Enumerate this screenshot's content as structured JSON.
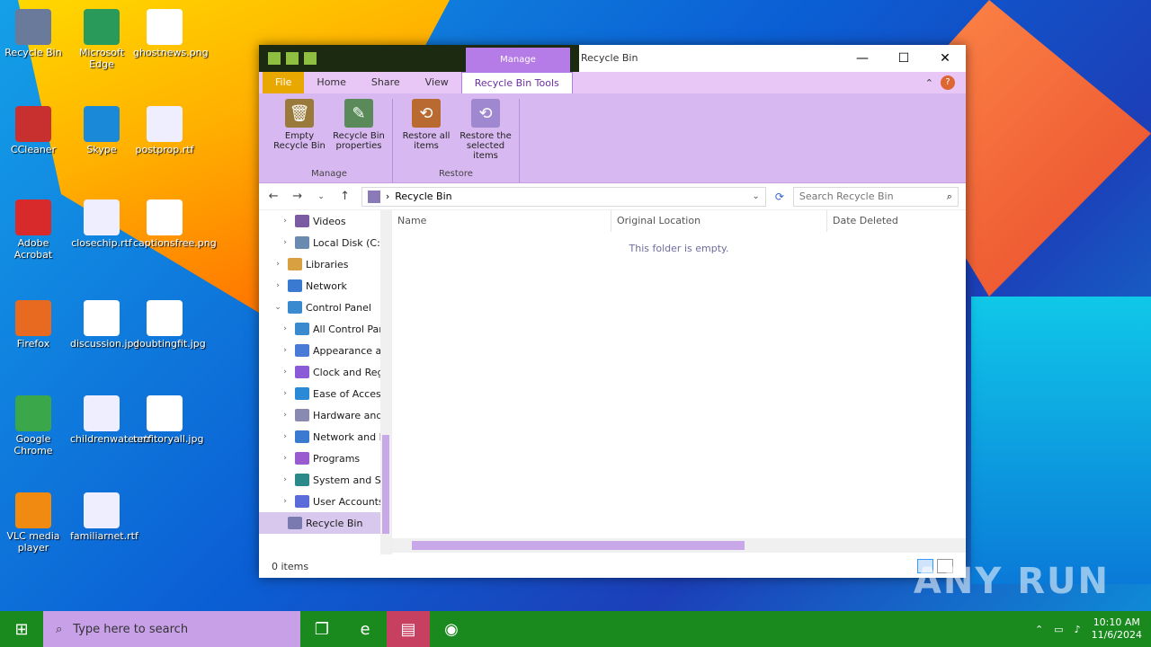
{
  "desktop": {
    "icons": [
      {
        "label": "Recycle Bin",
        "icon": "recycle-bin-icon"
      },
      {
        "label": "Microsoft Edge",
        "icon": "edge-icon"
      },
      {
        "label": "ghostnews.png",
        "icon": "image-file-icon"
      },
      {
        "label": "CCleaner",
        "icon": "ccleaner-icon"
      },
      {
        "label": "Skype",
        "icon": "skype-icon"
      },
      {
        "label": "postprop.rtf",
        "icon": "document-icon"
      },
      {
        "label": "Adobe Acrobat",
        "icon": "acrobat-icon"
      },
      {
        "label": "closechip.rtf",
        "icon": "document-icon"
      },
      {
        "label": "captionsfree.png",
        "icon": "image-file-icon"
      },
      {
        "label": "Firefox",
        "icon": "firefox-icon"
      },
      {
        "label": "discussion.jpg",
        "icon": "image-file-icon"
      },
      {
        "label": "doubtingfit.jpg",
        "icon": "image-file-icon"
      },
      {
        "label": "Google Chrome",
        "icon": "chrome-icon"
      },
      {
        "label": "childrenwater.rtf",
        "icon": "document-icon"
      },
      {
        "label": "territoryall.jpg",
        "icon": "image-file-icon"
      },
      {
        "label": "VLC media player",
        "icon": "vlc-icon"
      },
      {
        "label": "familiarnet.rtf",
        "icon": "document-icon"
      }
    ]
  },
  "window": {
    "context_tab": "Manage",
    "title": "Recycle Bin",
    "controls": {
      "minimize": "—",
      "maximize": "☐",
      "close": "✕"
    },
    "ribbon_tabs": [
      "File",
      "Home",
      "Share",
      "View",
      "Recycle Bin Tools"
    ],
    "ribbon": {
      "manage_group": {
        "label": "Manage",
        "buttons": [
          "Empty Recycle Bin",
          "Recycle Bin properties"
        ]
      },
      "restore_group": {
        "label": "Restore",
        "buttons": [
          "Restore all items",
          "Restore the selected items"
        ]
      }
    },
    "address": {
      "path": "Recycle Bin",
      "search_placeholder": "Search Recycle Bin"
    },
    "nav_items": [
      {
        "label": "Videos",
        "indent": 2,
        "icon": "videos-icon",
        "color": "#7a5aa0"
      },
      {
        "label": "Local Disk (C:)",
        "indent": 2,
        "icon": "drive-icon",
        "color": "#6a8ab0"
      },
      {
        "label": "Libraries",
        "indent": 1,
        "icon": "libraries-icon",
        "color": "#d8a040"
      },
      {
        "label": "Network",
        "indent": 1,
        "icon": "network-icon",
        "color": "#3a7ad0"
      },
      {
        "label": "Control Panel",
        "indent": 1,
        "icon": "control-panel-icon",
        "color": "#3a8ad0",
        "expanded": true
      },
      {
        "label": "All Control Par",
        "indent": 2,
        "icon": "control-panel-icon",
        "color": "#3a8ad0"
      },
      {
        "label": "Appearance an",
        "indent": 2,
        "icon": "appearance-icon",
        "color": "#4a7ad8"
      },
      {
        "label": "Clock and Reg",
        "indent": 2,
        "icon": "clock-icon",
        "color": "#8a5ad8"
      },
      {
        "label": "Ease of Access",
        "indent": 2,
        "icon": "ease-of-access-icon",
        "color": "#2a8ad8"
      },
      {
        "label": "Hardware and",
        "indent": 2,
        "icon": "hardware-icon",
        "color": "#8a8ab0"
      },
      {
        "label": "Network and In",
        "indent": 2,
        "icon": "network-icon",
        "color": "#3a7ad0"
      },
      {
        "label": "Programs",
        "indent": 2,
        "icon": "programs-icon",
        "color": "#9a5ad0"
      },
      {
        "label": "System and Se",
        "indent": 2,
        "icon": "system-icon",
        "color": "#2a8a8a"
      },
      {
        "label": "User Accounts",
        "indent": 2,
        "icon": "user-icon",
        "color": "#5a6ad8"
      },
      {
        "label": "Recycle Bin",
        "indent": 1,
        "icon": "recycle-bin-icon",
        "color": "#7a7ab0",
        "selected": true
      }
    ],
    "columns": [
      "Name",
      "Original Location",
      "Date Deleted"
    ],
    "empty_message": "This folder is empty.",
    "status": "0 items"
  },
  "taskbar": {
    "search_placeholder": "Type here to search",
    "time": "10:10 AM",
    "date": "11/6/2024"
  },
  "watermark": "ANY RUN"
}
